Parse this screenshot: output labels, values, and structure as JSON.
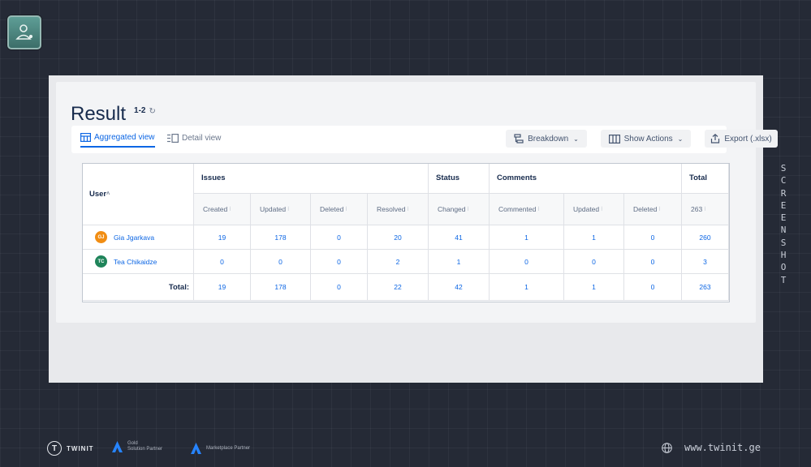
{
  "header": {
    "title": "Result",
    "range": "1-2",
    "refresh_icon": "↻"
  },
  "tabs": [
    {
      "label": "Aggregated view",
      "icon": "table-icon",
      "active": true
    },
    {
      "label": "Detail view",
      "icon": "list-detail-icon",
      "active": false
    }
  ],
  "toolbar": {
    "breakdown_label": "Breakdown",
    "show_actions_label": "Show Actions",
    "export_label": "Export (.xlsx)"
  },
  "table": {
    "user_header": "User",
    "groups": [
      "Issues",
      "Status",
      "Comments",
      "Total"
    ],
    "subheaders": [
      "Created",
      "Updated",
      "Deleted",
      "Resolved",
      "Changed",
      "Commented",
      "Updated",
      "Deleted",
      "263"
    ],
    "rows": [
      {
        "initials": "GJ",
        "avatar_color": "#f18d13",
        "user": "Gia Jgarkava",
        "values": [
          "19",
          "178",
          "0",
          "20",
          "41",
          "1",
          "1",
          "0",
          "260"
        ]
      },
      {
        "initials": "TC",
        "avatar_color": "#1f845a",
        "user": "Tea Chikaidze",
        "values": [
          "0",
          "0",
          "0",
          "2",
          "1",
          "0",
          "0",
          "0",
          "3"
        ]
      }
    ],
    "total_label": "Total:",
    "totals": [
      "19",
      "178",
      "0",
      "22",
      "42",
      "1",
      "1",
      "0",
      "263"
    ]
  },
  "side_text": "SCREENSHOT",
  "footer": {
    "brand": "TWINIT",
    "gold_line1": "Gold",
    "gold_line2": "Solution Partner",
    "marketplace": "Marketplace Partner",
    "url": "www.twinit.ge"
  },
  "colors": {
    "accent": "#0c66e4",
    "background": "#252a36"
  }
}
